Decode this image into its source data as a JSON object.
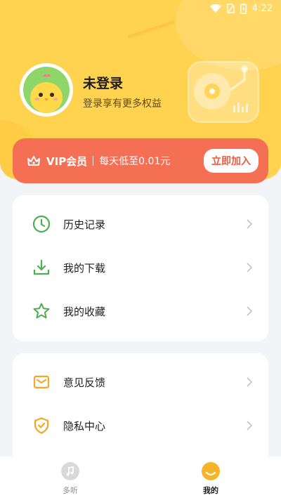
{
  "status_bar": {
    "time": "4:22"
  },
  "profile": {
    "name": "未登录",
    "subtitle": "登录享有更多权益"
  },
  "vip": {
    "label": "VIP会员",
    "description": "每天低至0.01元",
    "button_label": "立即加入"
  },
  "menu_group1": [
    {
      "label": "历史记录",
      "icon": "clock-icon"
    },
    {
      "label": "我的下载",
      "icon": "download-icon"
    },
    {
      "label": "我的收藏",
      "icon": "star-icon"
    }
  ],
  "menu_group2": [
    {
      "label": "意见反馈",
      "icon": "mail-icon"
    },
    {
      "label": "隐私中心",
      "icon": "shield-icon"
    }
  ],
  "bottom_nav": [
    {
      "label": "多听",
      "icon": "music-note-icon",
      "active": false
    },
    {
      "label": "我的",
      "icon": "profile-icon",
      "active": true
    }
  ],
  "colors": {
    "header": "#ffd24f",
    "vip_bar": "#f56f55",
    "menu_icon_green": "#4caf50",
    "menu_icon_orange": "#f5a623",
    "background": "#f3f4f7"
  }
}
